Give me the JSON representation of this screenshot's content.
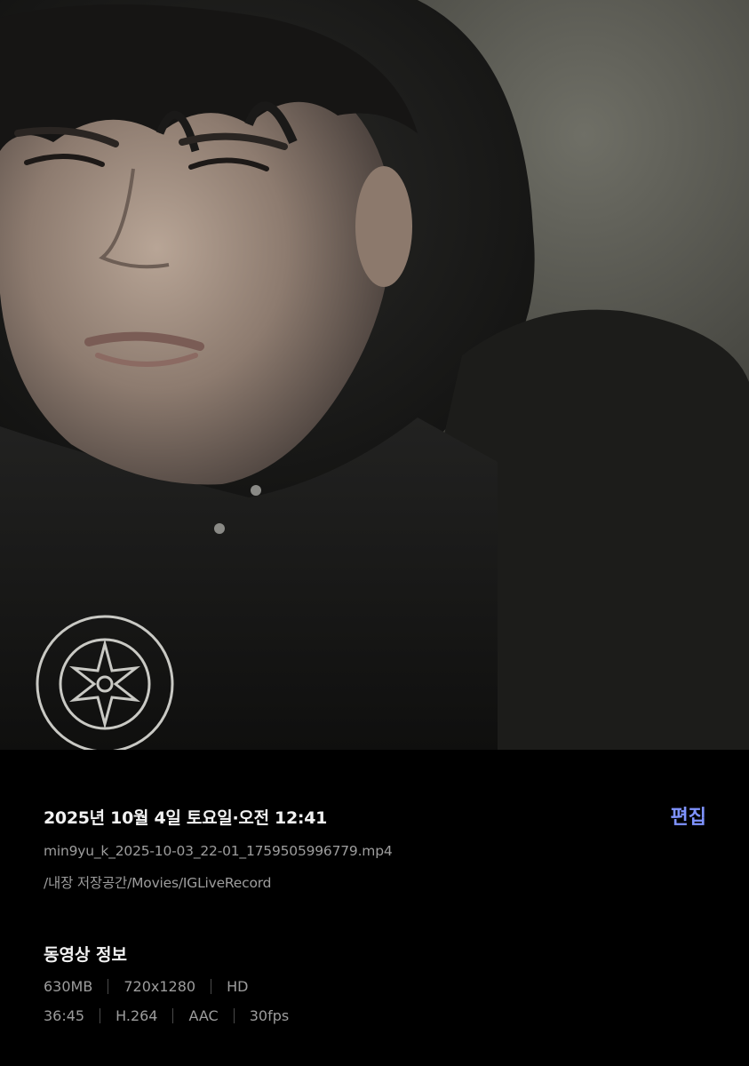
{
  "video": {
    "icon": "video-frame-photo"
  },
  "info": {
    "datetime": "2025년 10월 4일 토요일·오전 12:41",
    "edit_label": "편집",
    "filename": "min9yu_k_2025-10-03_22-01_1759505996779.mp4",
    "path": "/내장 저장공간/Movies/IGLiveRecord"
  },
  "details": {
    "title": "동영상 정보",
    "row1": [
      "630MB",
      "720x1280",
      "HD"
    ],
    "row2": [
      "36:45",
      "H.264",
      "AAC",
      "30fps"
    ]
  },
  "colors": {
    "background": "#000000",
    "accent": "#7f93ff",
    "primary_text": "#f2f2f2",
    "secondary_text": "#9d9d9d"
  }
}
